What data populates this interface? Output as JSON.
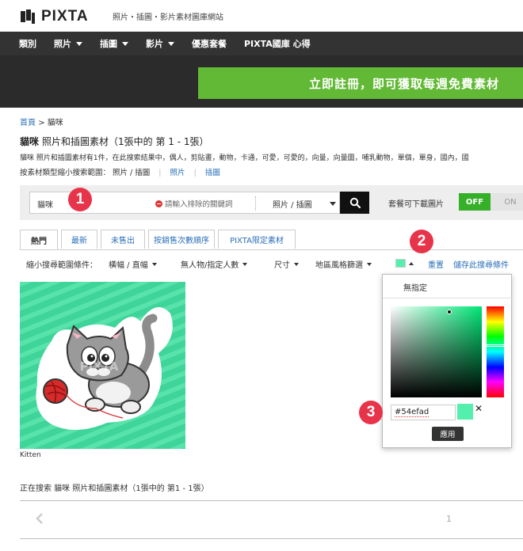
{
  "header": {
    "logo_text": "PIXTA",
    "tagline": "照片・插圖・影片素材圖庫網站"
  },
  "nav": {
    "items": [
      {
        "label": "類別"
      },
      {
        "label": "照片"
      },
      {
        "label": "插圖"
      },
      {
        "label": "影片"
      },
      {
        "label": "優惠套餐"
      },
      {
        "label": "PIXTA國庫 心得"
      }
    ]
  },
  "promo": {
    "label": "立即註冊，即可獲取每週免費素材"
  },
  "breadcrumb": {
    "home": "首頁",
    "separator": ">",
    "current": "貓咪"
  },
  "page_title": {
    "keyword": "貓咪",
    "rest": "照片和插圖素材（1張中的 第 1 - 1張）"
  },
  "description": "貓咪 照片和插圖素材有1件，在此搜索結果中，偶人，剪貼畫，動物，卡通，可愛，可愛的，向量，向量圖，哺乳動物，單個，單身，國內，國",
  "refine": {
    "label": "按素材類型縮小搜索範圍： 照片 / 插圖",
    "photo": "照片",
    "illustration": "插圖"
  },
  "search": {
    "term": "貓咪",
    "exclude_placeholder": "請輸入排除的關鍵詞",
    "type_select": "照片 / 插圖",
    "toggle_label": "套餐可下載圖片",
    "toggle_off": "OFF",
    "toggle_on": "ON"
  },
  "tabs": [
    {
      "label": "熱門",
      "active": true
    },
    {
      "label": "最新",
      "active": false
    },
    {
      "label": "未售出",
      "active": false
    },
    {
      "label": "按銷售次數順序",
      "active": false
    },
    {
      "label": "PIXTA限定素材",
      "active": false
    }
  ],
  "filters": {
    "label": "縮小搜尋範圍條件：",
    "orientation": "橫幅 / 直幅",
    "people": "無人物/指定人數",
    "size": "尺寸",
    "region": "地區風格篩選",
    "reset": "重置",
    "save": "儲存此搜尋條件"
  },
  "result": {
    "caption": "Kitten",
    "watermark": "PIXTA"
  },
  "color_picker": {
    "none_label": "無指定",
    "hex_value": "#54efad",
    "selected_color": "#54efad",
    "apply_label": "應用"
  },
  "badges": [
    "1",
    "2",
    "3"
  ],
  "footer": {
    "summary": "正在搜索 貓咪 照片和插圖素材（1張中的 第1 - 1張）",
    "page": "1"
  },
  "colors": {
    "accent_green": "#62b935",
    "toggle_green": "#35b028",
    "link_blue": "#2a6fb8",
    "badge_red": "#e8344a",
    "nav_bg": "#333333"
  }
}
